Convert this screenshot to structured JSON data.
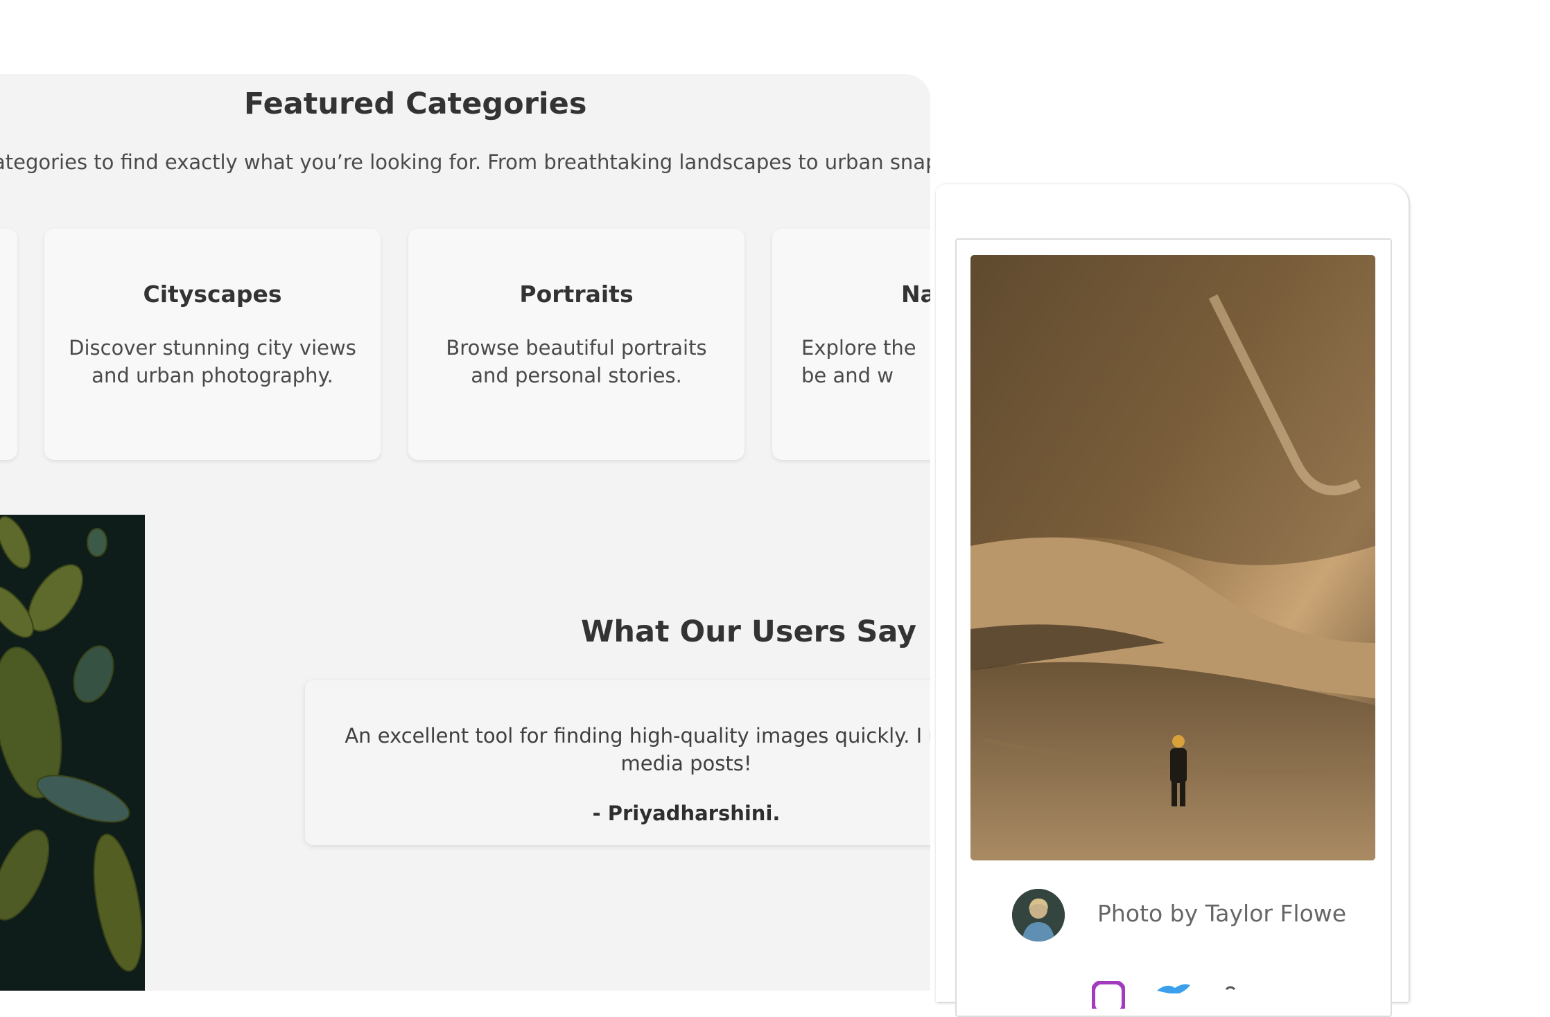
{
  "featured": {
    "title": "Featured Categories",
    "intro": "ategories to find exactly what you’re looking for. From breathtaking landscapes to urban snapsho"
  },
  "categories": [
    {
      "title": "Cityscapes",
      "desc": "Discover stunning city views and urban photography."
    },
    {
      "title": "Portraits",
      "desc": "Browse beautiful portraits and personal stories."
    },
    {
      "title": "Na",
      "desc": "Explore the be and w"
    }
  ],
  "testimonials": {
    "title": "What Our Users Say",
    "quote": "An excellent tool for finding high-quality images quickly. I use social media posts!",
    "author": "- Priyadharshini."
  },
  "photo_card": {
    "credit": "Photo by Taylor Flowe",
    "social_icons": [
      "instagram-icon",
      "twitter-icon",
      "link-icon"
    ]
  }
}
